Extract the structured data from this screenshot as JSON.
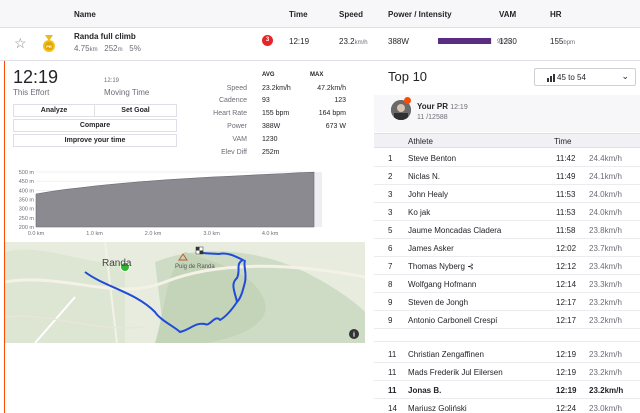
{
  "header": {
    "name": "Name",
    "time": "Time",
    "speed": "Speed",
    "power": "Power / Intensity",
    "vam": "VAM",
    "hr": "HR"
  },
  "segment": {
    "name": "Randa full climb",
    "distance": "4.75",
    "distance_unit": "km",
    "elev": "252",
    "elev_unit": "m",
    "grade": "5%",
    "rank_badge": "3",
    "medal_label": "PR",
    "time": "12:19",
    "speed": "23.2",
    "speed_unit": "km/h",
    "power": "388W",
    "intensity": "98 %",
    "intensity_value": 0.98,
    "vam": "1230",
    "hr": "155",
    "hr_unit": "bpm"
  },
  "effort": {
    "time": "12:19",
    "this_effort_label": "This Effort",
    "moving_time": "12:19",
    "moving_time_label": "Moving Time",
    "buttons": {
      "analyze": "Analyze",
      "set_goal": "Set Goal",
      "compare": "Compare",
      "improve": "Improve your time"
    }
  },
  "stats": {
    "avg_label": "AVG",
    "max_label": "MAX",
    "rows": [
      {
        "label": "Speed",
        "avg": "23.2km/h",
        "max": "47.2km/h"
      },
      {
        "label": "Cadence",
        "avg": "93",
        "max": "123"
      },
      {
        "label": "Heart Rate",
        "avg": "155 bpm",
        "max": "164 bpm"
      },
      {
        "label": "Power",
        "avg": "388W",
        "max": "673 W"
      },
      {
        "label": "VAM",
        "avg": "1230",
        "max": ""
      },
      {
        "label": "Elev Diff",
        "avg": "252m",
        "max": ""
      }
    ]
  },
  "chart_data": {
    "type": "area",
    "title": "",
    "xlabel": "",
    "ylabel": "",
    "x_ticks": [
      "0.0 km",
      "1.0 km",
      "2.0 km",
      "3.0 km",
      "4.0 km"
    ],
    "y_ticks": [
      "500 m",
      "450 m",
      "400 m",
      "350 m",
      "300 m",
      "250 m",
      "200 m"
    ],
    "xlim": [
      0,
      4.75
    ],
    "ylim": [
      200,
      500
    ],
    "x": [
      0,
      0.25,
      0.5,
      0.75,
      1.0,
      1.25,
      1.5,
      1.75,
      2.0,
      2.25,
      2.5,
      2.75,
      3.0,
      3.25,
      3.5,
      3.75,
      4.0,
      4.25,
      4.5,
      4.75
    ],
    "y": [
      380,
      393,
      405,
      414,
      423,
      431,
      439,
      446,
      452,
      458,
      463,
      468,
      472,
      476,
      480,
      484,
      488,
      492,
      496,
      499
    ]
  },
  "map": {
    "town_label": "Randa",
    "peak_label": "Puig de Randa",
    "info_icon": "info-icon"
  },
  "leaderboard": {
    "title": "Top 10",
    "filter_label": "45 to 54",
    "pr_label": "Your PR",
    "pr_time": "12:19",
    "pr_rank": "11 /12588",
    "columns": {
      "athlete": "Athlete",
      "time": "Time"
    },
    "rows": [
      {
        "rank": "1",
        "athlete": "Steve Benton",
        "time": "11:42",
        "speed": "24.4km/h"
      },
      {
        "rank": "2",
        "athlete": "Niclas N.",
        "time": "11:49",
        "speed": "24.1km/h"
      },
      {
        "rank": "3",
        "athlete": "John Healy",
        "time": "11:53",
        "speed": "24.0km/h"
      },
      {
        "rank": "3",
        "athlete": "Ko jak",
        "time": "11:53",
        "speed": "24.0km/h"
      },
      {
        "rank": "5",
        "athlete": "Jaume Moncadas Cladera",
        "time": "11:58",
        "speed": "23.8km/h"
      },
      {
        "rank": "6",
        "athlete": "James Asker",
        "time": "12:02",
        "speed": "23.7km/h"
      },
      {
        "rank": "7",
        "athlete": "Thomas Nyberg ⊰",
        "time": "12:12",
        "speed": "23.4km/h"
      },
      {
        "rank": "8",
        "athlete": "Wolfgang Hofmann",
        "time": "12:14",
        "speed": "23.3km/h"
      },
      {
        "rank": "9",
        "athlete": "Steven de Jongh",
        "time": "12:17",
        "speed": "23.2km/h"
      },
      {
        "rank": "9",
        "athlete": "Antonio Carbonell Crespí",
        "time": "12:17",
        "speed": "23.2km/h"
      },
      {
        "rank": "11",
        "athlete": "Christian Zengaffinen",
        "time": "12:19",
        "speed": "23.2km/h"
      },
      {
        "rank": "11",
        "athlete": "Mads Frederik Jul Eilersen",
        "time": "12:19",
        "speed": "23.2km/h"
      },
      {
        "rank": "11",
        "athlete": "Jonas B.",
        "time": "12:19",
        "speed": "23.2km/h",
        "highlight": true
      },
      {
        "rank": "14",
        "athlete": "Mariusz Goliński",
        "time": "12:24",
        "speed": "23.0km/h"
      }
    ]
  },
  "colors": {
    "accent": "#fc4c02",
    "route": "#1f4bd8",
    "power_bar": "#5a2d82",
    "badge": "#e3262a"
  }
}
